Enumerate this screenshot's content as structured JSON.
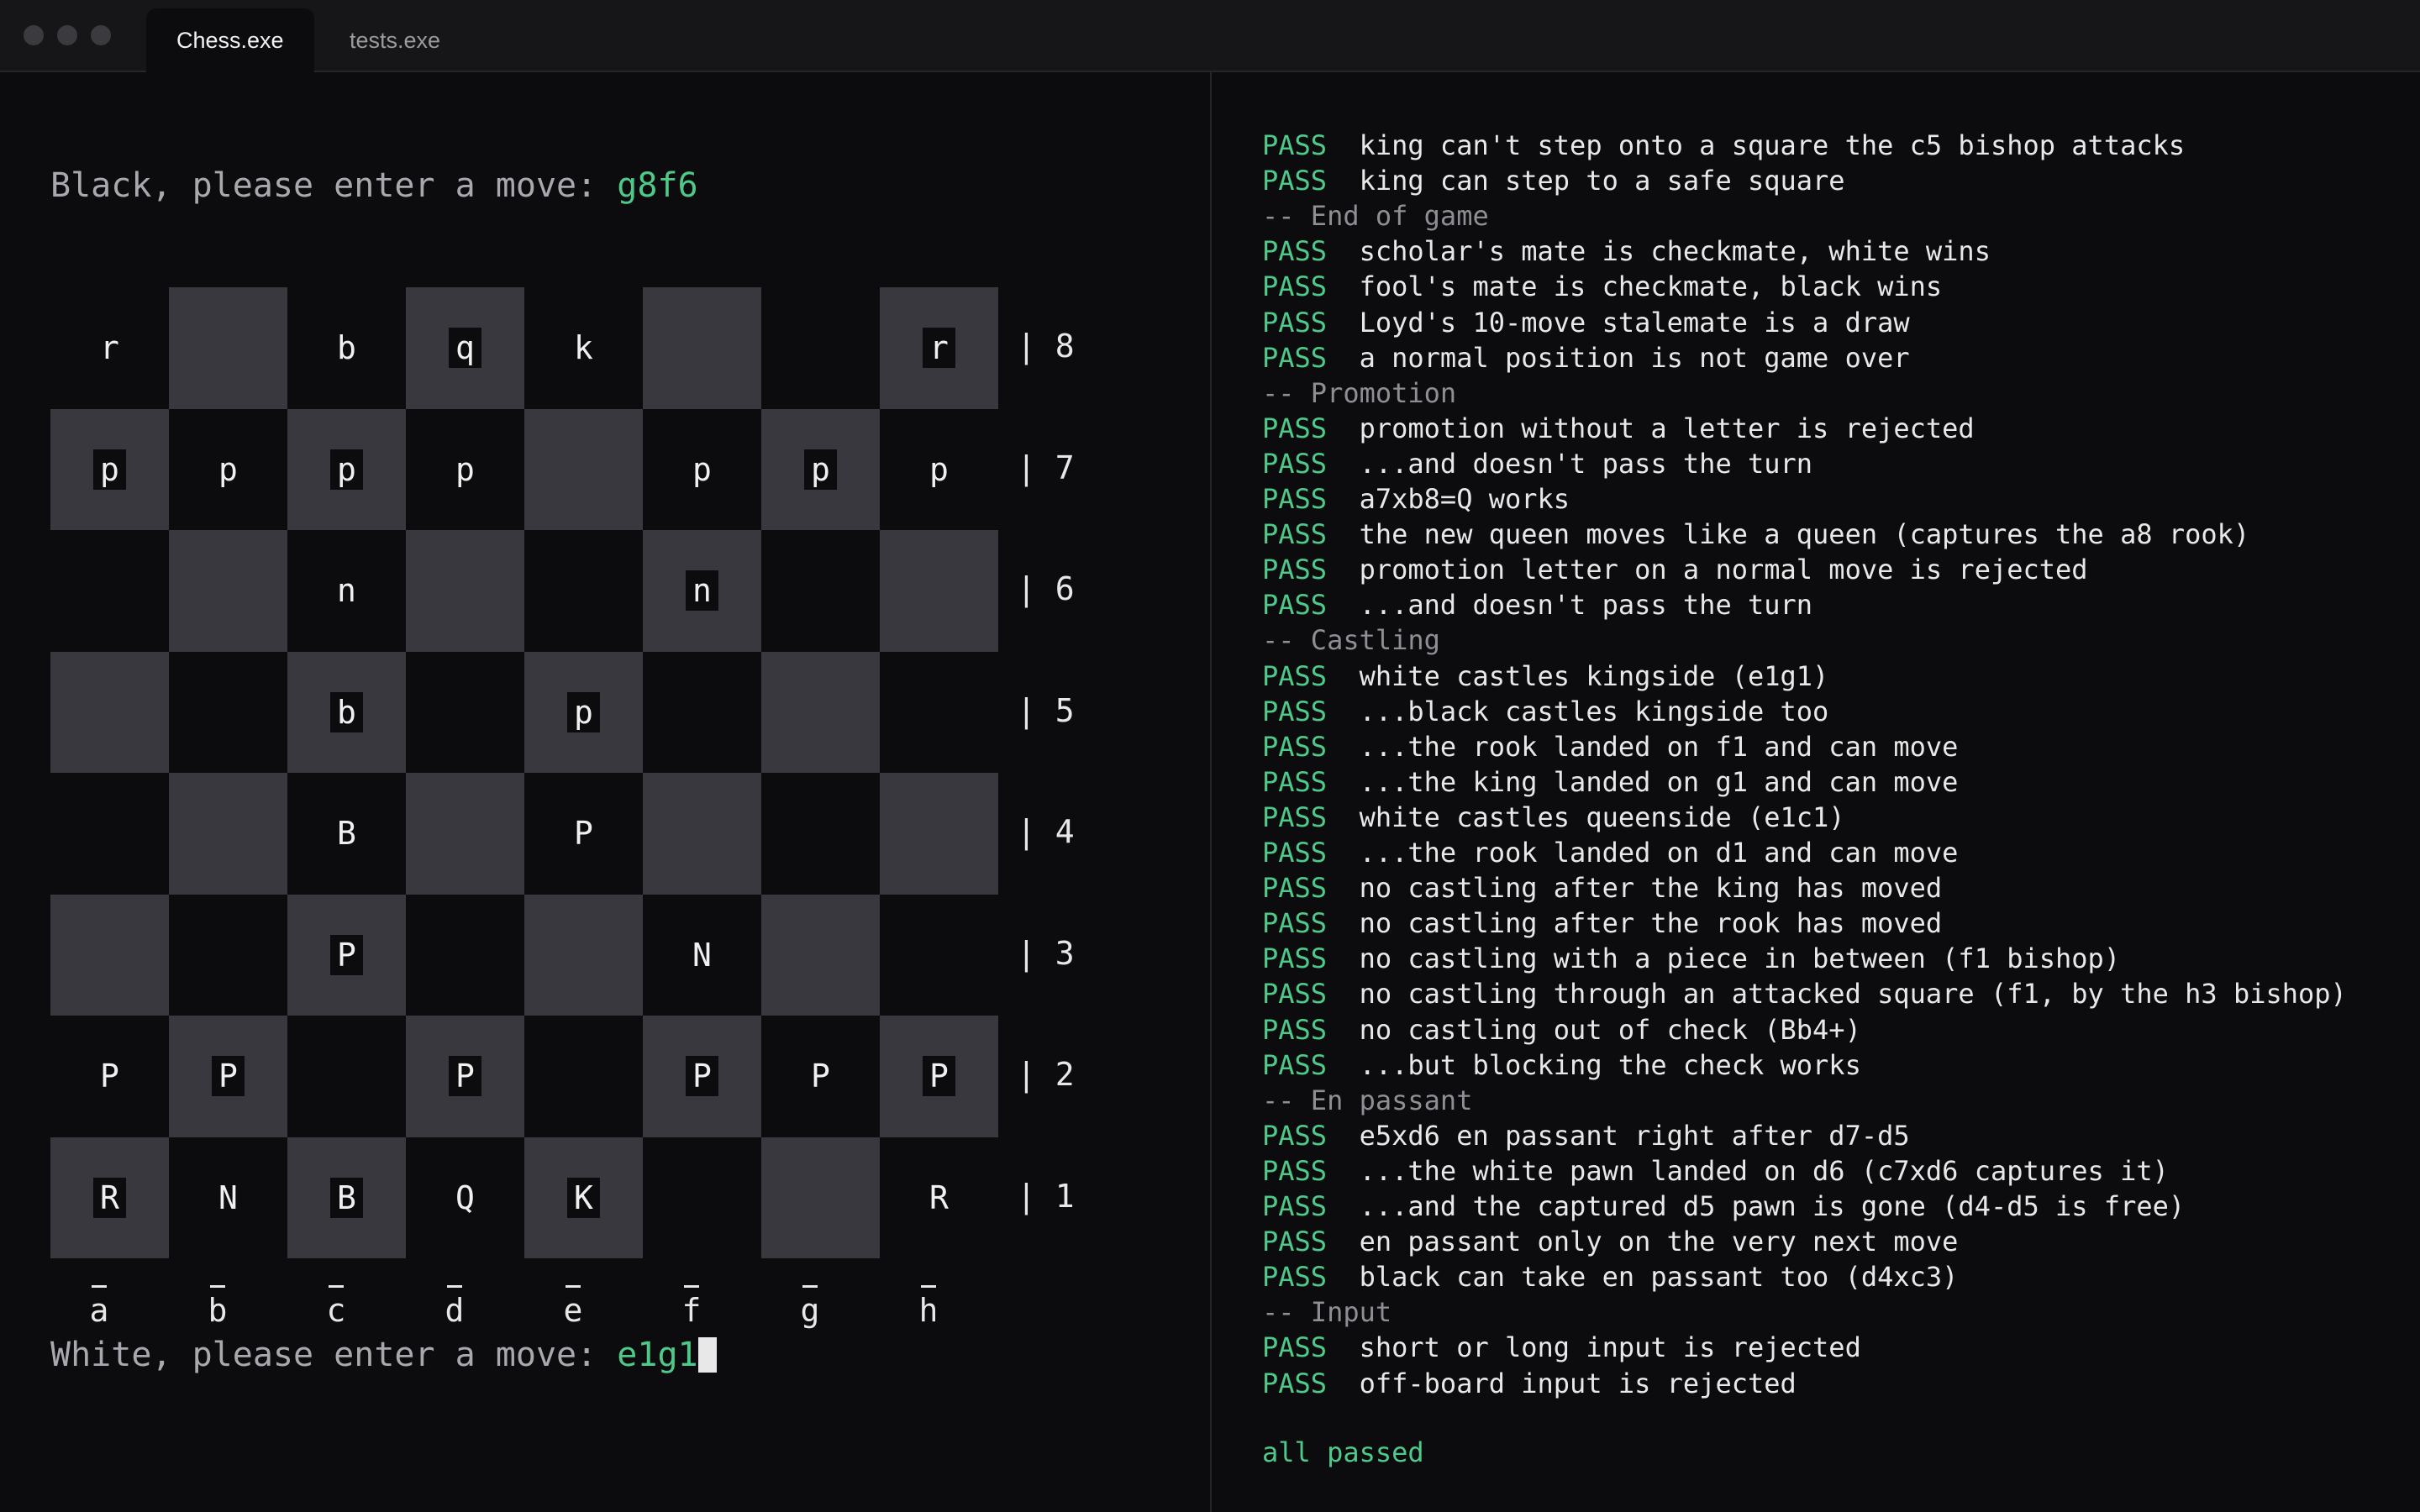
{
  "window": {
    "tabs": [
      {
        "label": "Chess.exe",
        "active": true
      },
      {
        "label": "tests.exe",
        "active": false
      }
    ]
  },
  "colors": {
    "background": "#0c0c0e",
    "dark_square": "#38383e",
    "accent_green": "#4ec98a",
    "prompt_gray": "#a8a8ae"
  },
  "chess": {
    "prompt_top": {
      "text": "Black, please enter a move: ",
      "move": "g8f6"
    },
    "prompt_bottom": {
      "text": "White, please enter a move: ",
      "move": "e1g1"
    },
    "ranks": [
      "| 8",
      "| 7",
      "| 6",
      "| 5",
      "| 4",
      "| 3",
      "| 2",
      "| 1"
    ],
    "files": [
      "a",
      "b",
      "c",
      "d",
      "e",
      "f",
      "g",
      "h"
    ],
    "board": [
      [
        "r",
        "",
        "b",
        "q",
        "k",
        "",
        "",
        "r"
      ],
      [
        "p",
        "p",
        "p",
        "p",
        "",
        "p",
        "p",
        "p"
      ],
      [
        "",
        "",
        "n",
        "",
        "",
        "n",
        "",
        ""
      ],
      [
        "",
        "",
        "b",
        "",
        "p",
        "",
        "",
        ""
      ],
      [
        "",
        "",
        "B",
        "",
        "P",
        "",
        "",
        ""
      ],
      [
        "",
        "",
        "P",
        "",
        "",
        "N",
        "",
        ""
      ],
      [
        "P",
        "P",
        "",
        "P",
        "",
        "P",
        "P",
        "P"
      ],
      [
        "R",
        "N",
        "B",
        "Q",
        "K",
        "",
        "",
        "R"
      ]
    ]
  },
  "tests": {
    "lines": [
      {
        "kind": "pass",
        "status": "PASS",
        "text": "king can't step onto a square the c5 bishop attacks"
      },
      {
        "kind": "pass",
        "status": "PASS",
        "text": "king can step to a safe square"
      },
      {
        "kind": "section",
        "text": "-- End of game"
      },
      {
        "kind": "pass",
        "status": "PASS",
        "text": "scholar's mate is checkmate, white wins"
      },
      {
        "kind": "pass",
        "status": "PASS",
        "text": "fool's mate is checkmate, black wins"
      },
      {
        "kind": "pass",
        "status": "PASS",
        "text": "Loyd's 10-move stalemate is a draw"
      },
      {
        "kind": "pass",
        "status": "PASS",
        "text": "a normal position is not game over"
      },
      {
        "kind": "section",
        "text": "-- Promotion"
      },
      {
        "kind": "pass",
        "status": "PASS",
        "text": "promotion without a letter is rejected"
      },
      {
        "kind": "pass",
        "status": "PASS",
        "text": "...and doesn't pass the turn"
      },
      {
        "kind": "pass",
        "status": "PASS",
        "text": "a7xb8=Q works"
      },
      {
        "kind": "pass",
        "status": "PASS",
        "text": "the new queen moves like a queen (captures the a8 rook)"
      },
      {
        "kind": "pass",
        "status": "PASS",
        "text": "promotion letter on a normal move is rejected"
      },
      {
        "kind": "pass",
        "status": "PASS",
        "text": "...and doesn't pass the turn"
      },
      {
        "kind": "section",
        "text": "-- Castling"
      },
      {
        "kind": "pass",
        "status": "PASS",
        "text": "white castles kingside (e1g1)"
      },
      {
        "kind": "pass",
        "status": "PASS",
        "text": "...black castles kingside too"
      },
      {
        "kind": "pass",
        "status": "PASS",
        "text": "...the rook landed on f1 and can move"
      },
      {
        "kind": "pass",
        "status": "PASS",
        "text": "...the king landed on g1 and can move"
      },
      {
        "kind": "pass",
        "status": "PASS",
        "text": "white castles queenside (e1c1)"
      },
      {
        "kind": "pass",
        "status": "PASS",
        "text": "...the rook landed on d1 and can move"
      },
      {
        "kind": "pass",
        "status": "PASS",
        "text": "no castling after the king has moved"
      },
      {
        "kind": "pass",
        "status": "PASS",
        "text": "no castling after the rook has moved"
      },
      {
        "kind": "pass",
        "status": "PASS",
        "text": "no castling with a piece in between (f1 bishop)"
      },
      {
        "kind": "pass",
        "status": "PASS",
        "text": "no castling through an attacked square (f1, by the h3 bishop)"
      },
      {
        "kind": "pass",
        "status": "PASS",
        "text": "no castling out of check (Bb4+)"
      },
      {
        "kind": "pass",
        "status": "PASS",
        "text": "...but blocking the check works"
      },
      {
        "kind": "section",
        "text": "-- En passant"
      },
      {
        "kind": "pass",
        "status": "PASS",
        "text": "e5xd6 en passant right after d7-d5"
      },
      {
        "kind": "pass",
        "status": "PASS",
        "text": "...the white pawn landed on d6 (c7xd6 captures it)"
      },
      {
        "kind": "pass",
        "status": "PASS",
        "text": "...and the captured d5 pawn is gone (d4-d5 is free)"
      },
      {
        "kind": "pass",
        "status": "PASS",
        "text": "en passant only on the very next move"
      },
      {
        "kind": "pass",
        "status": "PASS",
        "text": "black can take en passant too (d4xc3)"
      },
      {
        "kind": "section",
        "text": "-- Input"
      },
      {
        "kind": "pass",
        "status": "PASS",
        "text": "short or long input is rejected"
      },
      {
        "kind": "pass",
        "status": "PASS",
        "text": "off-board input is rejected"
      }
    ],
    "summary": "all passed"
  }
}
